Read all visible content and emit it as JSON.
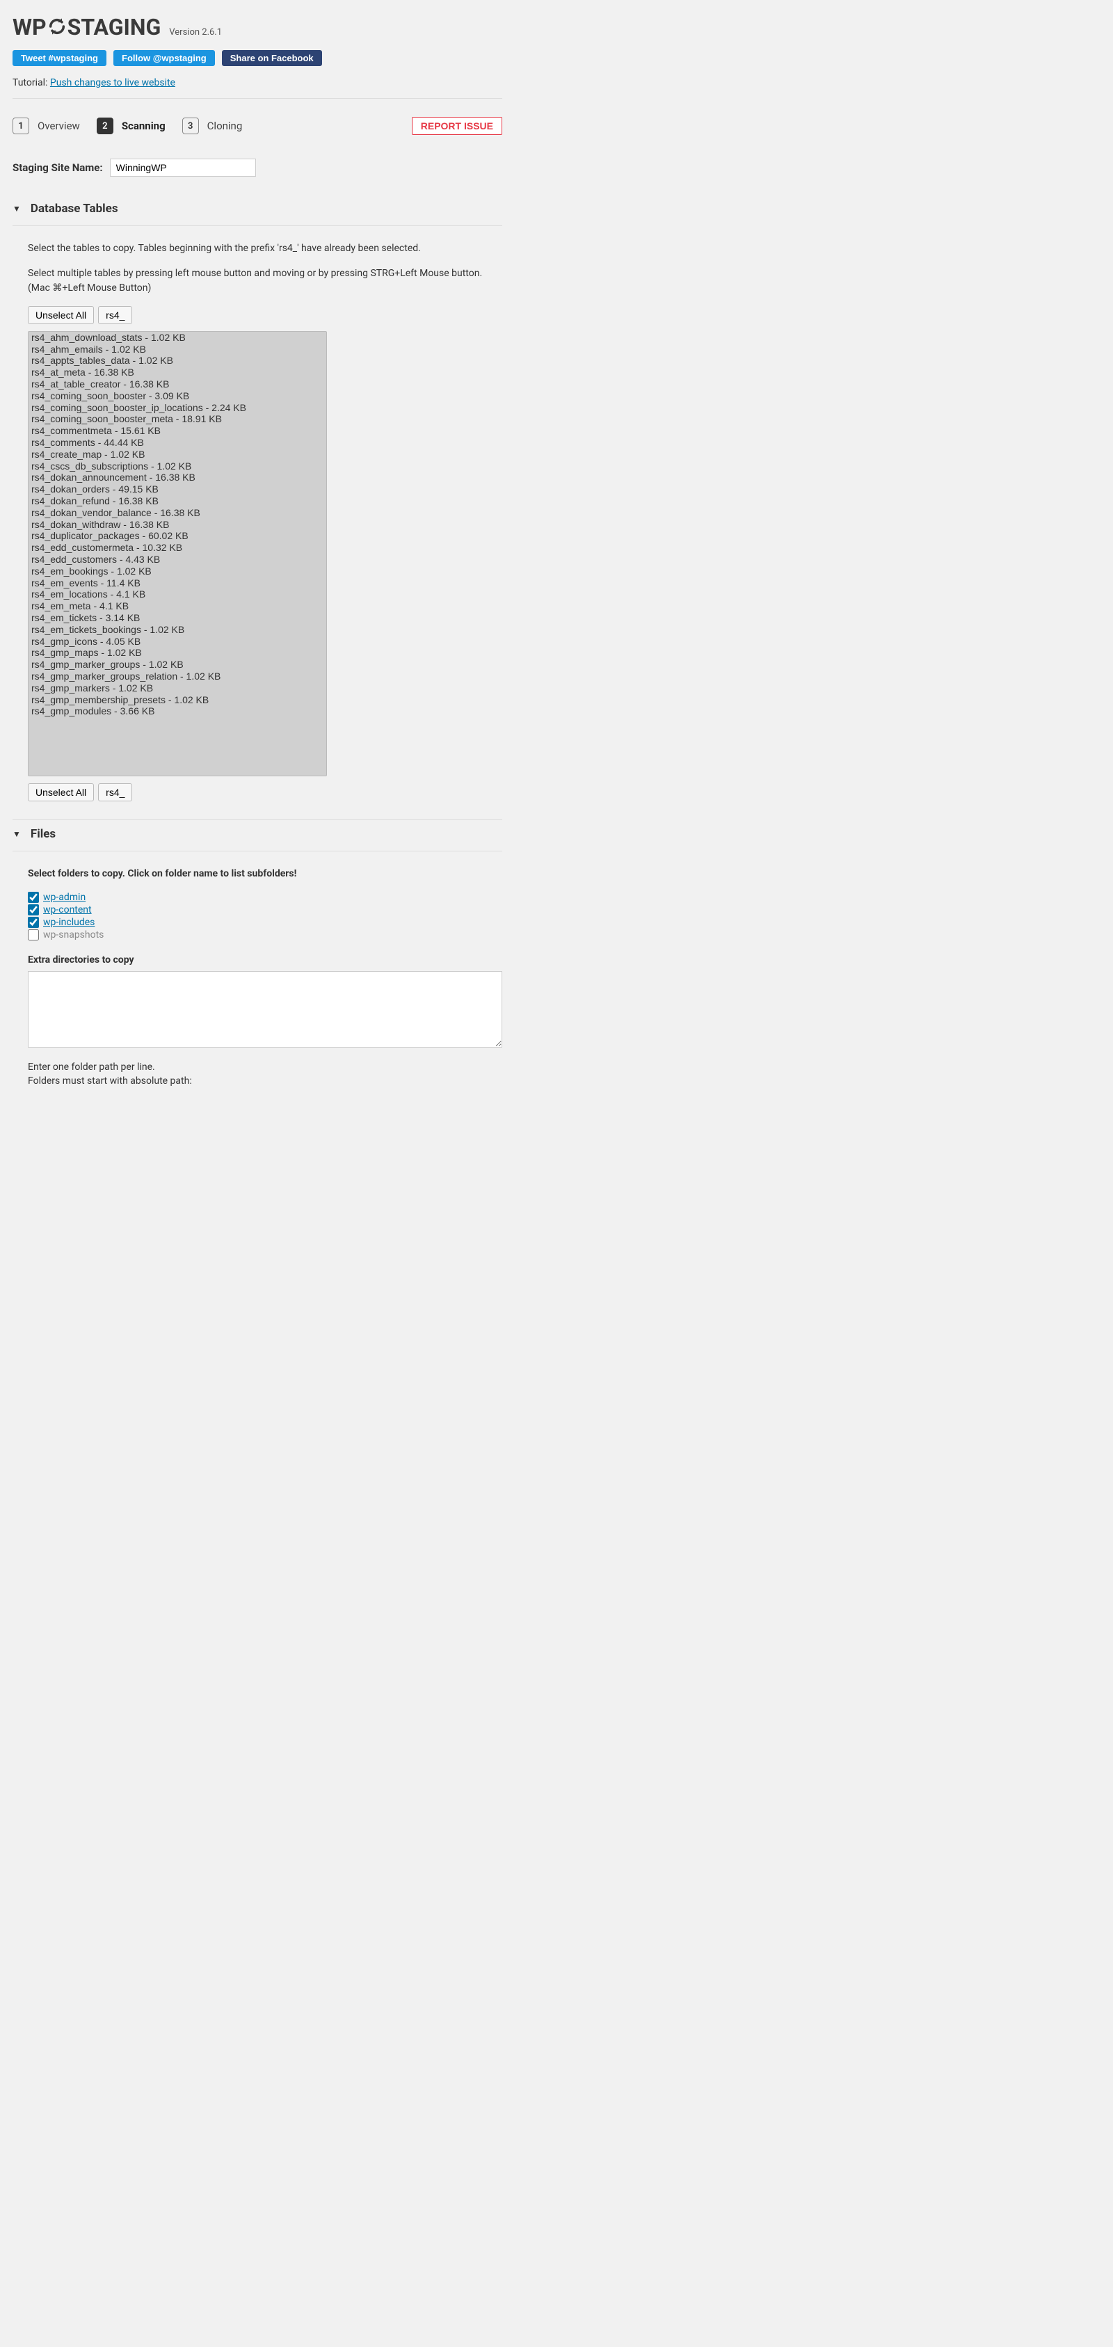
{
  "header": {
    "logo_pre": "WP",
    "logo_post": "STAGING",
    "version": "Version 2.6.1"
  },
  "share": {
    "tweet": "Tweet #wpstaging",
    "follow": "Follow @wpstaging",
    "facebook": "Share on Facebook"
  },
  "tutorial": {
    "label": "Tutorial: ",
    "link_text": "Push changes to live website"
  },
  "steps": [
    {
      "num": "1",
      "label": "Overview",
      "active": false
    },
    {
      "num": "2",
      "label": "Scanning",
      "active": true
    },
    {
      "num": "3",
      "label": "Cloning",
      "active": false
    }
  ],
  "report_issue": "REPORT ISSUE",
  "site_name": {
    "label": "Staging Site Name:",
    "value": "WinningWP"
  },
  "db_section": {
    "title": "Database Tables",
    "desc1": "Select the tables to copy. Tables beginning with the prefix 'rs4_' have already been selected.",
    "desc2": "Select multiple tables by pressing left mouse button and moving or by pressing STRG+Left Mouse button. (Mac ⌘+Left Mouse Button)",
    "unselect": "Unselect All",
    "prefix": "rs4_",
    "tables": [
      "rs4_ahm_download_stats - 1.02 KB",
      "rs4_ahm_emails - 1.02 KB",
      "rs4_appts_tables_data - 1.02 KB",
      "rs4_at_meta - 16.38 KB",
      "rs4_at_table_creator - 16.38 KB",
      "rs4_coming_soon_booster - 3.09 KB",
      "rs4_coming_soon_booster_ip_locations - 2.24 KB",
      "rs4_coming_soon_booster_meta - 18.91 KB",
      "rs4_commentmeta - 15.61 KB",
      "rs4_comments - 44.44 KB",
      "rs4_create_map - 1.02 KB",
      "rs4_cscs_db_subscriptions - 1.02 KB",
      "rs4_dokan_announcement - 16.38 KB",
      "rs4_dokan_orders - 49.15 KB",
      "rs4_dokan_refund - 16.38 KB",
      "rs4_dokan_vendor_balance - 16.38 KB",
      "rs4_dokan_withdraw - 16.38 KB",
      "rs4_duplicator_packages - 60.02 KB",
      "rs4_edd_customermeta - 10.32 KB",
      "rs4_edd_customers - 4.43 KB",
      "rs4_em_bookings - 1.02 KB",
      "rs4_em_events - 11.4 KB",
      "rs4_em_locations - 4.1 KB",
      "rs4_em_meta - 4.1 KB",
      "rs4_em_tickets - 3.14 KB",
      "rs4_em_tickets_bookings - 1.02 KB",
      "rs4_gmp_icons - 4.05 KB",
      "rs4_gmp_maps - 1.02 KB",
      "rs4_gmp_marker_groups - 1.02 KB",
      "rs4_gmp_marker_groups_relation - 1.02 KB",
      "rs4_gmp_markers - 1.02 KB",
      "rs4_gmp_membership_presets - 1.02 KB",
      "rs4_gmp_modules - 3.66 KB"
    ]
  },
  "files_section": {
    "title": "Files",
    "desc": "Select folders to copy. Click on folder name to list subfolders!",
    "folders": [
      {
        "name": "wp-admin",
        "checked": true,
        "link": true
      },
      {
        "name": "wp-content",
        "checked": true,
        "link": true
      },
      {
        "name": "wp-includes",
        "checked": true,
        "link": true
      },
      {
        "name": "wp-snapshots",
        "checked": false,
        "link": false
      }
    ],
    "extra_label": "Extra directories to copy",
    "hint1": "Enter one folder path per line.",
    "hint2": "Folders must start with absolute path:"
  }
}
